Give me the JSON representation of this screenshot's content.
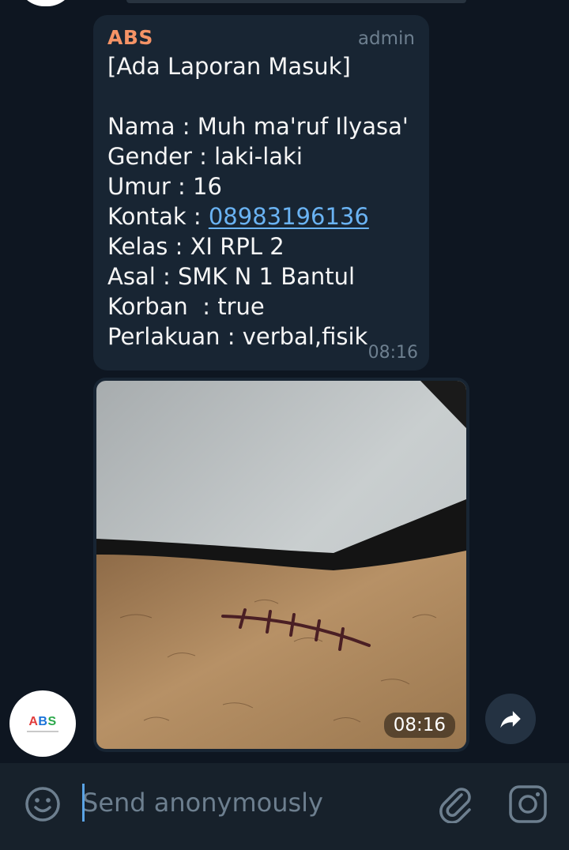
{
  "message": {
    "sender": "ABS",
    "role": "admin",
    "title": "[Ada Laporan Masuk]",
    "fields": [
      {
        "label": "Nama : ",
        "value": "Muh ma'ruf Ilyasa'"
      },
      {
        "label": "Gender : ",
        "value": "laki-laki"
      },
      {
        "label": "Umur : ",
        "value": "16"
      },
      {
        "label": "Kontak : ",
        "value": "08983196136"
      },
      {
        "label": "Kelas : ",
        "value": "XI RPL 2"
      },
      {
        "label": "Asal : ",
        "value": "SMK N 1 Bantul"
      },
      {
        "label": "Korban  : ",
        "value": "true"
      },
      {
        "label": "Perlakuan : ",
        "value": "verbal,fisik"
      }
    ],
    "time": "08:16"
  },
  "photo": {
    "time": "08:16",
    "subject": "photo of forearm with drawn stitched-scar marking"
  },
  "avatar": {
    "logo_letters": [
      "A",
      "B",
      "S"
    ]
  },
  "icons": {
    "share": "share-arrow-icon",
    "emoji": "smiley-icon",
    "attach": "paperclip-icon",
    "camera": "instagram-camera-icon"
  },
  "composer": {
    "placeholder": "Send anonymously"
  },
  "colors": {
    "background": "#0e1621",
    "bubble": "#182533",
    "sender": "#f59366",
    "link": "#6ab3f3",
    "meta": "#6d7f8f",
    "composer": "#17212b"
  }
}
